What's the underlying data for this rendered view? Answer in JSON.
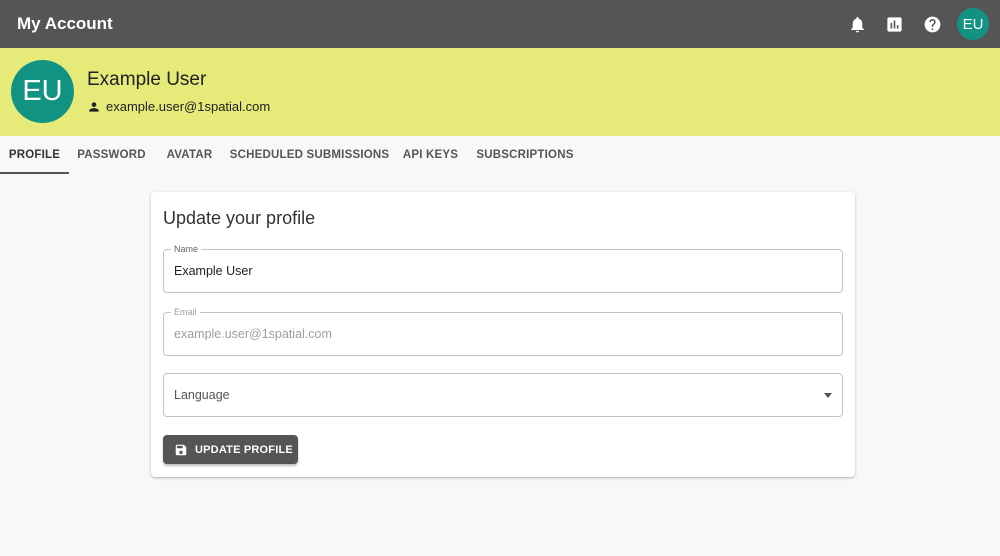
{
  "appbar": {
    "title": "My Account",
    "icons": [
      "bell-icon",
      "chart-icon",
      "help-icon"
    ],
    "avatar_initials": "EU",
    "background": "#555555"
  },
  "profile": {
    "initials": "EU",
    "name": "Example User",
    "email": "example.user@1spatial.com",
    "banner_color": "#e6ea79",
    "avatar_color": "#119384"
  },
  "tabs": [
    {
      "label": "PROFILE",
      "active": true
    },
    {
      "label": "PASSWORD",
      "active": false
    },
    {
      "label": "AVATAR",
      "active": false
    },
    {
      "label": "SCHEDULED SUBMISSIONS",
      "active": false
    },
    {
      "label": "API KEYS",
      "active": false
    },
    {
      "label": "SUBSCRIPTIONS",
      "active": false
    }
  ],
  "form": {
    "title": "Update your profile",
    "name_label": "Name",
    "name_value": "Example User",
    "email_label": "Email",
    "email_value": "example.user@1spatial.com",
    "language_placeholder": "Language",
    "submit_label": "UPDATE PROFILE"
  }
}
